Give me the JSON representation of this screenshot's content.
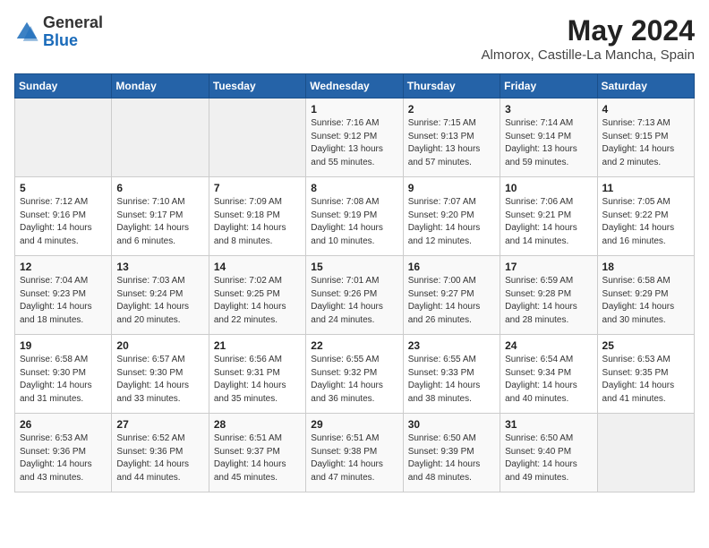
{
  "header": {
    "logo_general": "General",
    "logo_blue": "Blue",
    "month_year": "May 2024",
    "location": "Almorox, Castille-La Mancha, Spain"
  },
  "days_of_week": [
    "Sunday",
    "Monday",
    "Tuesday",
    "Wednesday",
    "Thursday",
    "Friday",
    "Saturday"
  ],
  "weeks": [
    [
      {
        "day": "",
        "info": ""
      },
      {
        "day": "",
        "info": ""
      },
      {
        "day": "",
        "info": ""
      },
      {
        "day": "1",
        "info": "Sunrise: 7:16 AM\nSunset: 9:12 PM\nDaylight: 13 hours\nand 55 minutes."
      },
      {
        "day": "2",
        "info": "Sunrise: 7:15 AM\nSunset: 9:13 PM\nDaylight: 13 hours\nand 57 minutes."
      },
      {
        "day": "3",
        "info": "Sunrise: 7:14 AM\nSunset: 9:14 PM\nDaylight: 13 hours\nand 59 minutes."
      },
      {
        "day": "4",
        "info": "Sunrise: 7:13 AM\nSunset: 9:15 PM\nDaylight: 14 hours\nand 2 minutes."
      }
    ],
    [
      {
        "day": "5",
        "info": "Sunrise: 7:12 AM\nSunset: 9:16 PM\nDaylight: 14 hours\nand 4 minutes."
      },
      {
        "day": "6",
        "info": "Sunrise: 7:10 AM\nSunset: 9:17 PM\nDaylight: 14 hours\nand 6 minutes."
      },
      {
        "day": "7",
        "info": "Sunrise: 7:09 AM\nSunset: 9:18 PM\nDaylight: 14 hours\nand 8 minutes."
      },
      {
        "day": "8",
        "info": "Sunrise: 7:08 AM\nSunset: 9:19 PM\nDaylight: 14 hours\nand 10 minutes."
      },
      {
        "day": "9",
        "info": "Sunrise: 7:07 AM\nSunset: 9:20 PM\nDaylight: 14 hours\nand 12 minutes."
      },
      {
        "day": "10",
        "info": "Sunrise: 7:06 AM\nSunset: 9:21 PM\nDaylight: 14 hours\nand 14 minutes."
      },
      {
        "day": "11",
        "info": "Sunrise: 7:05 AM\nSunset: 9:22 PM\nDaylight: 14 hours\nand 16 minutes."
      }
    ],
    [
      {
        "day": "12",
        "info": "Sunrise: 7:04 AM\nSunset: 9:23 PM\nDaylight: 14 hours\nand 18 minutes."
      },
      {
        "day": "13",
        "info": "Sunrise: 7:03 AM\nSunset: 9:24 PM\nDaylight: 14 hours\nand 20 minutes."
      },
      {
        "day": "14",
        "info": "Sunrise: 7:02 AM\nSunset: 9:25 PM\nDaylight: 14 hours\nand 22 minutes."
      },
      {
        "day": "15",
        "info": "Sunrise: 7:01 AM\nSunset: 9:26 PM\nDaylight: 14 hours\nand 24 minutes."
      },
      {
        "day": "16",
        "info": "Sunrise: 7:00 AM\nSunset: 9:27 PM\nDaylight: 14 hours\nand 26 minutes."
      },
      {
        "day": "17",
        "info": "Sunrise: 6:59 AM\nSunset: 9:28 PM\nDaylight: 14 hours\nand 28 minutes."
      },
      {
        "day": "18",
        "info": "Sunrise: 6:58 AM\nSunset: 9:29 PM\nDaylight: 14 hours\nand 30 minutes."
      }
    ],
    [
      {
        "day": "19",
        "info": "Sunrise: 6:58 AM\nSunset: 9:30 PM\nDaylight: 14 hours\nand 31 minutes."
      },
      {
        "day": "20",
        "info": "Sunrise: 6:57 AM\nSunset: 9:30 PM\nDaylight: 14 hours\nand 33 minutes."
      },
      {
        "day": "21",
        "info": "Sunrise: 6:56 AM\nSunset: 9:31 PM\nDaylight: 14 hours\nand 35 minutes."
      },
      {
        "day": "22",
        "info": "Sunrise: 6:55 AM\nSunset: 9:32 PM\nDaylight: 14 hours\nand 36 minutes."
      },
      {
        "day": "23",
        "info": "Sunrise: 6:55 AM\nSunset: 9:33 PM\nDaylight: 14 hours\nand 38 minutes."
      },
      {
        "day": "24",
        "info": "Sunrise: 6:54 AM\nSunset: 9:34 PM\nDaylight: 14 hours\nand 40 minutes."
      },
      {
        "day": "25",
        "info": "Sunrise: 6:53 AM\nSunset: 9:35 PM\nDaylight: 14 hours\nand 41 minutes."
      }
    ],
    [
      {
        "day": "26",
        "info": "Sunrise: 6:53 AM\nSunset: 9:36 PM\nDaylight: 14 hours\nand 43 minutes."
      },
      {
        "day": "27",
        "info": "Sunrise: 6:52 AM\nSunset: 9:36 PM\nDaylight: 14 hours\nand 44 minutes."
      },
      {
        "day": "28",
        "info": "Sunrise: 6:51 AM\nSunset: 9:37 PM\nDaylight: 14 hours\nand 45 minutes."
      },
      {
        "day": "29",
        "info": "Sunrise: 6:51 AM\nSunset: 9:38 PM\nDaylight: 14 hours\nand 47 minutes."
      },
      {
        "day": "30",
        "info": "Sunrise: 6:50 AM\nSunset: 9:39 PM\nDaylight: 14 hours\nand 48 minutes."
      },
      {
        "day": "31",
        "info": "Sunrise: 6:50 AM\nSunset: 9:40 PM\nDaylight: 14 hours\nand 49 minutes."
      },
      {
        "day": "",
        "info": ""
      }
    ]
  ]
}
